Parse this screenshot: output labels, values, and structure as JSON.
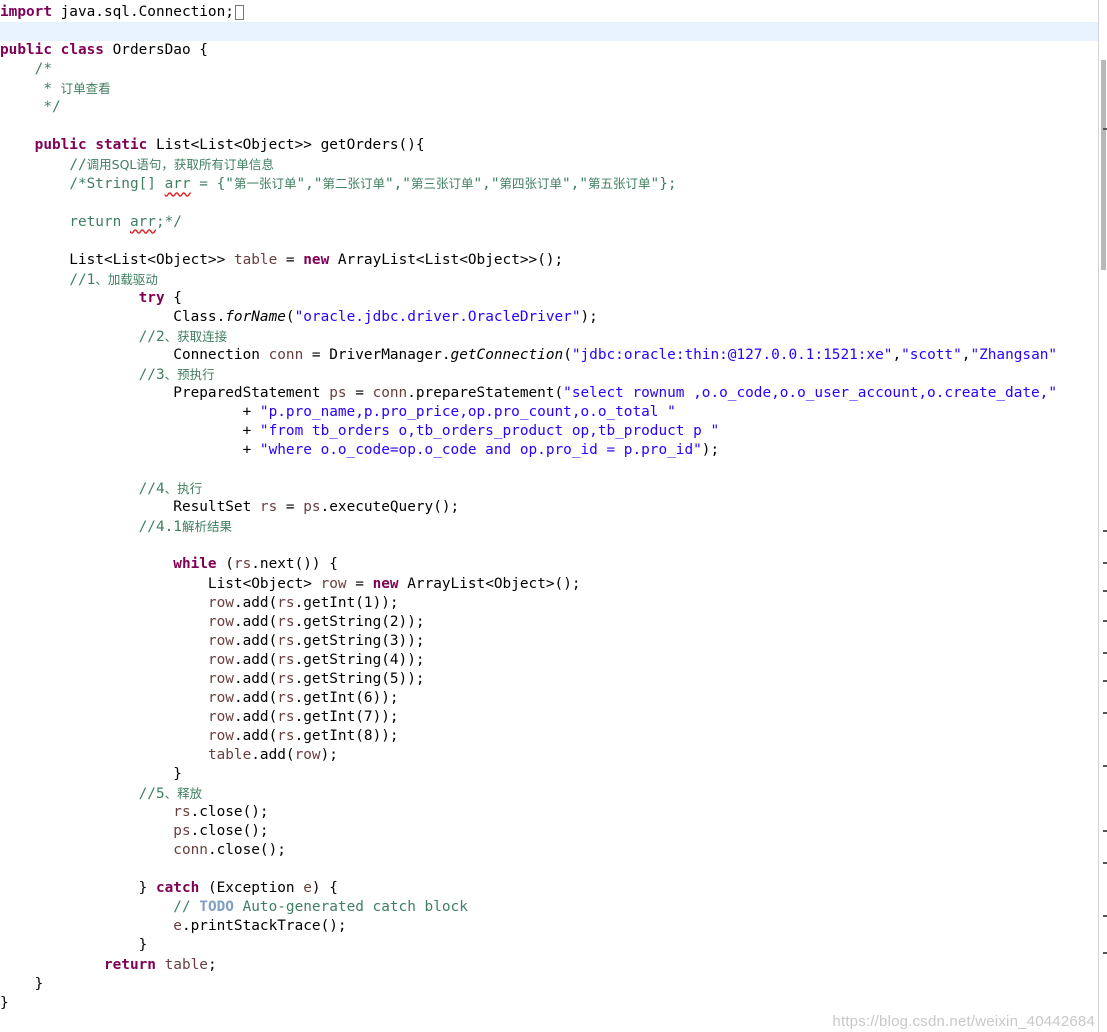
{
  "editor": {
    "lines": [
      [
        {
          "t": "import",
          "c": "kw"
        },
        {
          "t": " java.sql.Connection;"
        },
        {
          "caret": true
        }
      ],
      [],
      [
        {
          "t": "public",
          "c": "kw"
        },
        {
          "t": " "
        },
        {
          "t": "class",
          "c": "kw"
        },
        {
          "t": " OrdersDao {"
        }
      ],
      [
        {
          "t": "    "
        },
        {
          "t": "/*",
          "c": "cm"
        }
      ],
      [
        {
          "t": "     * ",
          "c": "cm"
        },
        {
          "t": "订单查看",
          "c": "cm cjk"
        }
      ],
      [
        {
          "t": "     */",
          "c": "cm"
        }
      ],
      [],
      [
        {
          "t": "    "
        },
        {
          "t": "public",
          "c": "kw"
        },
        {
          "t": " "
        },
        {
          "t": "static",
          "c": "kw"
        },
        {
          "t": " List<List<Object>> getOrders(){"
        }
      ],
      [
        {
          "t": "        "
        },
        {
          "t": "//",
          "c": "cm"
        },
        {
          "t": "调用SQL语句，获取所有订单信息",
          "c": "cm cjk"
        }
      ],
      [
        {
          "t": "        "
        },
        {
          "t": "/*String[] ",
          "c": "cm"
        },
        {
          "t": "arr",
          "c": "cm sq"
        },
        {
          "t": " = {\"",
          "c": "cm"
        },
        {
          "t": "第一张订单",
          "c": "cm cjk"
        },
        {
          "t": "\",\"",
          "c": "cm"
        },
        {
          "t": "第二张订单",
          "c": "cm cjk"
        },
        {
          "t": "\",\"",
          "c": "cm"
        },
        {
          "t": "第三张订单",
          "c": "cm cjk"
        },
        {
          "t": "\",\"",
          "c": "cm"
        },
        {
          "t": "第四张订单",
          "c": "cm cjk"
        },
        {
          "t": "\",\"",
          "c": "cm"
        },
        {
          "t": "第五张订单",
          "c": "cm cjk"
        },
        {
          "t": "\"};",
          "c": "cm"
        }
      ],
      [],
      [
        {
          "t": "        "
        },
        {
          "t": "return ",
          "c": "cm"
        },
        {
          "t": "arr",
          "c": "cm sq"
        },
        {
          "t": ";*/",
          "c": "cm"
        }
      ],
      [],
      [
        {
          "t": "        List<List<Object>> "
        },
        {
          "t": "table",
          "c": "loc"
        },
        {
          "t": " = "
        },
        {
          "t": "new",
          "c": "kw"
        },
        {
          "t": " ArrayList<List<Object>>();"
        }
      ],
      [
        {
          "t": "        "
        },
        {
          "t": "//1",
          "c": "cm"
        },
        {
          "t": "、加载驱动",
          "c": "cm cjk"
        }
      ],
      [
        {
          "t": "                "
        },
        {
          "t": "try",
          "c": "kw"
        },
        {
          "t": " {"
        }
      ],
      [
        {
          "t": "                    Class."
        },
        {
          "t": "forName",
          "c": "it"
        },
        {
          "t": "("
        },
        {
          "t": "\"oracle.jdbc.driver.OracleDriver\"",
          "c": "str"
        },
        {
          "t": ");"
        }
      ],
      [
        {
          "t": "                "
        },
        {
          "t": "//2",
          "c": "cm"
        },
        {
          "t": "、获取连接",
          "c": "cm cjk"
        }
      ],
      [
        {
          "t": "                    Connection "
        },
        {
          "t": "conn",
          "c": "loc"
        },
        {
          "t": " = DriverManager."
        },
        {
          "t": "getConnection",
          "c": "it"
        },
        {
          "t": "("
        },
        {
          "t": "\"jdbc:oracle:thin:@127.0.0.1:1521:xe\"",
          "c": "str"
        },
        {
          "t": ","
        },
        {
          "t": "\"scott\"",
          "c": "str"
        },
        {
          "t": ","
        },
        {
          "t": "\"Zhangsan\"",
          "c": "str"
        }
      ],
      [
        {
          "t": "                "
        },
        {
          "t": "//3",
          "c": "cm"
        },
        {
          "t": "、预执行",
          "c": "cm cjk"
        }
      ],
      [
        {
          "t": "                    PreparedStatement "
        },
        {
          "t": "ps",
          "c": "loc"
        },
        {
          "t": " = "
        },
        {
          "t": "conn",
          "c": "loc"
        },
        {
          "t": ".prepareStatement("
        },
        {
          "t": "\"select rownum ,o.o_code,o.o_user_account,o.create_date,\"",
          "c": "str"
        }
      ],
      [
        {
          "t": "                            + "
        },
        {
          "t": "\"p.pro_name,p.pro_price,op.pro_count,o.o_total \"",
          "c": "str"
        }
      ],
      [
        {
          "t": "                            + "
        },
        {
          "t": "\"from tb_orders o,tb_orders_product op,tb_product p \"",
          "c": "str"
        }
      ],
      [
        {
          "t": "                            + "
        },
        {
          "t": "\"where o.o_code=op.o_code and op.pro_id = p.pro_id\"",
          "c": "str"
        },
        {
          "t": ");"
        }
      ],
      [],
      [
        {
          "t": "                "
        },
        {
          "t": "//4",
          "c": "cm"
        },
        {
          "t": "、执行",
          "c": "cm cjk"
        }
      ],
      [
        {
          "t": "                    ResultSet "
        },
        {
          "t": "rs",
          "c": "loc"
        },
        {
          "t": " = "
        },
        {
          "t": "ps",
          "c": "loc"
        },
        {
          "t": ".executeQuery();"
        }
      ],
      [
        {
          "t": "                "
        },
        {
          "t": "//4.1",
          "c": "cm"
        },
        {
          "t": "解析结果",
          "c": "cm cjk"
        }
      ],
      [],
      [
        {
          "t": "                    "
        },
        {
          "t": "while",
          "c": "kw"
        },
        {
          "t": " ("
        },
        {
          "t": "rs",
          "c": "loc"
        },
        {
          "t": ".next()) {"
        }
      ],
      [
        {
          "t": "                        List<Object> "
        },
        {
          "t": "row",
          "c": "loc"
        },
        {
          "t": " = "
        },
        {
          "t": "new",
          "c": "kw"
        },
        {
          "t": " ArrayList<Object>();"
        }
      ],
      [
        {
          "t": "                        "
        },
        {
          "t": "row",
          "c": "loc"
        },
        {
          "t": ".add("
        },
        {
          "t": "rs",
          "c": "loc"
        },
        {
          "t": ".getInt(1));"
        }
      ],
      [
        {
          "t": "                        "
        },
        {
          "t": "row",
          "c": "loc"
        },
        {
          "t": ".add("
        },
        {
          "t": "rs",
          "c": "loc"
        },
        {
          "t": ".getString(2));"
        }
      ],
      [
        {
          "t": "                        "
        },
        {
          "t": "row",
          "c": "loc"
        },
        {
          "t": ".add("
        },
        {
          "t": "rs",
          "c": "loc"
        },
        {
          "t": ".getString(3));"
        }
      ],
      [
        {
          "t": "                        "
        },
        {
          "t": "row",
          "c": "loc"
        },
        {
          "t": ".add("
        },
        {
          "t": "rs",
          "c": "loc"
        },
        {
          "t": ".getString(4));"
        }
      ],
      [
        {
          "t": "                        "
        },
        {
          "t": "row",
          "c": "loc"
        },
        {
          "t": ".add("
        },
        {
          "t": "rs",
          "c": "loc"
        },
        {
          "t": ".getString(5));"
        }
      ],
      [
        {
          "t": "                        "
        },
        {
          "t": "row",
          "c": "loc"
        },
        {
          "t": ".add("
        },
        {
          "t": "rs",
          "c": "loc"
        },
        {
          "t": ".getInt(6));"
        }
      ],
      [
        {
          "t": "                        "
        },
        {
          "t": "row",
          "c": "loc"
        },
        {
          "t": ".add("
        },
        {
          "t": "rs",
          "c": "loc"
        },
        {
          "t": ".getInt(7));"
        }
      ],
      [
        {
          "t": "                        "
        },
        {
          "t": "row",
          "c": "loc"
        },
        {
          "t": ".add("
        },
        {
          "t": "rs",
          "c": "loc"
        },
        {
          "t": ".getInt(8));"
        }
      ],
      [
        {
          "t": "                        "
        },
        {
          "t": "table",
          "c": "loc"
        },
        {
          "t": ".add("
        },
        {
          "t": "row",
          "c": "loc"
        },
        {
          "t": ");"
        }
      ],
      [
        {
          "t": "                    }"
        }
      ],
      [
        {
          "t": "                "
        },
        {
          "t": "//5",
          "c": "cm"
        },
        {
          "t": "、释放",
          "c": "cm cjk"
        }
      ],
      [
        {
          "t": "                    "
        },
        {
          "t": "rs",
          "c": "loc"
        },
        {
          "t": ".close();"
        }
      ],
      [
        {
          "t": "                    "
        },
        {
          "t": "ps",
          "c": "loc"
        },
        {
          "t": ".close();"
        }
      ],
      [
        {
          "t": "                    "
        },
        {
          "t": "conn",
          "c": "loc"
        },
        {
          "t": ".close();"
        }
      ],
      [],
      [
        {
          "t": "                } "
        },
        {
          "t": "catch",
          "c": "kw"
        },
        {
          "t": " (Exception "
        },
        {
          "t": "e",
          "c": "loc"
        },
        {
          "t": ") {"
        }
      ],
      [
        {
          "t": "                    "
        },
        {
          "t": "// ",
          "c": "cm"
        },
        {
          "t": "TODO",
          "c": "todo"
        },
        {
          "t": " Auto-generated catch block",
          "c": "cm"
        }
      ],
      [
        {
          "t": "                    "
        },
        {
          "t": "e",
          "c": "loc"
        },
        {
          "t": ".printStackTrace();"
        }
      ],
      [
        {
          "t": "                }"
        }
      ],
      [
        {
          "t": "            "
        },
        {
          "t": "return",
          "c": "kw"
        },
        {
          "t": " "
        },
        {
          "t": "table",
          "c": "loc"
        },
        {
          "t": ";"
        }
      ],
      [
        {
          "t": "    }"
        }
      ],
      [
        {
          "t": "}"
        }
      ]
    ]
  },
  "watermark": "https://blog.csdn.net/weixin_40442684"
}
